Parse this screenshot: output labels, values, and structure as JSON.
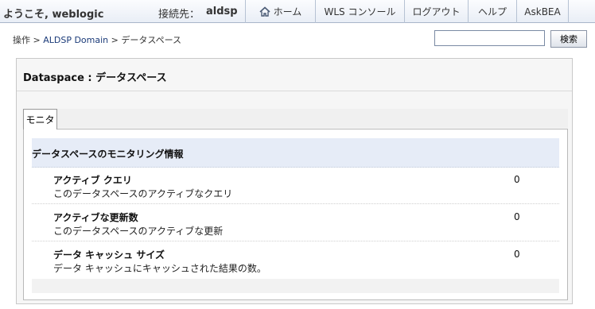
{
  "header": {
    "welcome": "ようこそ, weblogic",
    "connection_label": "接続先：",
    "connection_value": "aldsp",
    "nav": [
      {
        "label": "ホーム",
        "icon": "home-icon"
      },
      {
        "label": "WLS コンソール"
      },
      {
        "label": "ログアウト"
      },
      {
        "label": "ヘルプ"
      },
      {
        "label": "AskBEA"
      }
    ]
  },
  "breadcrumb": {
    "items": [
      "操作",
      "ALDSP Domain",
      "データスペース"
    ],
    "separator": ">"
  },
  "search": {
    "value": "",
    "placeholder": "",
    "button_label": "検索"
  },
  "panel": {
    "title": "Dataspace : データスペース",
    "tabs": [
      {
        "label": "モニタ",
        "active": true
      }
    ],
    "section_title": "データスペースのモニタリング情報",
    "rows": [
      {
        "label": "アクティブ クエリ",
        "description": "このデータスペースのアクティブなクエリ",
        "value": "0"
      },
      {
        "label": "アクティブな更新数",
        "description": "このデータスペースのアクティブな更新",
        "value": "0"
      },
      {
        "label": "データ キャッシュ サイズ",
        "description": "データ キャッシュにキャッシュされた結果の数。",
        "value": "0"
      }
    ]
  },
  "colors": {
    "topbar_bg": "#e9eef6",
    "section_header_bg": "#e6ecf7",
    "link": "#1a3a78"
  }
}
